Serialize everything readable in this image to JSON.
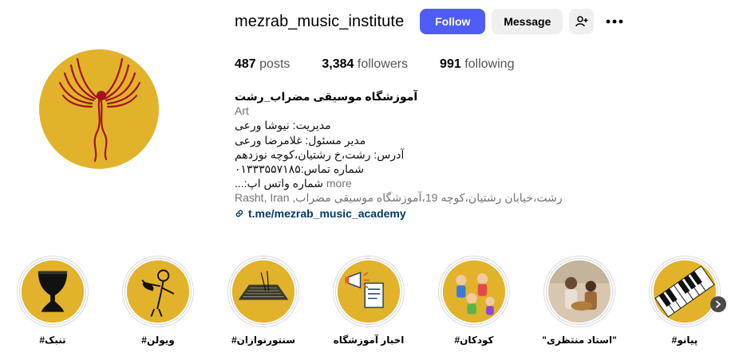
{
  "profile": {
    "username": "mezrab_music_institute",
    "follow_label": "Follow",
    "message_label": "Message",
    "posts_count": "487",
    "posts_label": "posts",
    "followers_count": "3,384",
    "followers_label": "followers",
    "following_count": "991",
    "following_label": "following"
  },
  "bio": {
    "name": "آموزشگاه موسیقی مضراب_رشت",
    "category": "Art",
    "lines": [
      "مدیریت: نیوشا ورعی",
      "مدیر مسئول: غلامرضا ورعی",
      "آدرس: رشت،خ رشتیان،کوچه نوزدهم",
      "شماره تماس:۰۱۳۳۳۵۵۷۱۸۵",
      "شماره واتس اپ:..."
    ],
    "more_label": "more",
    "address": "Rasht, Iran ,رشت،خیابان رشتیان،کوچه 19،آموزشگاه موسیقی مضراب",
    "link": "t.me/mezrab_music_academy"
  },
  "highlights": [
    {
      "label": "#تنبک",
      "icon": "tombak-drum-icon"
    },
    {
      "label": "#ویولن",
      "icon": "violinist-icon"
    },
    {
      "label": "#سنتورنوازان",
      "icon": "santur-icon"
    },
    {
      "label": "اخبار آموزشگاه",
      "icon": "megaphone-news-icon"
    },
    {
      "label": "#کودکان",
      "icon": "children-icon"
    },
    {
      "label": "\"استاد منتظری\"",
      "icon": "photo-thumbnail"
    },
    {
      "label": "#پیانو",
      "icon": "piano-keys-icon"
    }
  ],
  "colors": {
    "follow_button": "#4f5df5",
    "highlight_bg": "#e2b22b",
    "link": "#00376b"
  }
}
